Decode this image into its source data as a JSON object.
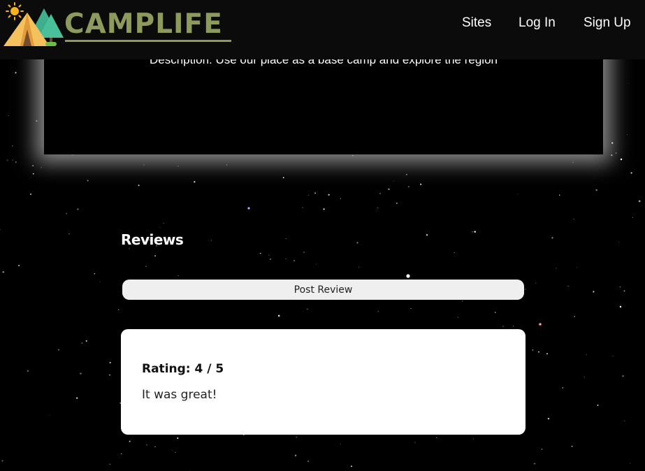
{
  "header": {
    "logo_text": "CAMPLIFE",
    "brand_color": "#8c9b5c",
    "nav": [
      {
        "label": "Sites"
      },
      {
        "label": "Log In"
      },
      {
        "label": "Sign Up"
      }
    ]
  },
  "site": {
    "description": "Description: Use our place as a base camp and explore the region"
  },
  "reviews": {
    "heading": "Reviews",
    "post_button": "Post Review",
    "items": [
      {
        "rating_text": "Rating: 4 / 5",
        "text": "It was great!"
      }
    ]
  },
  "background": {
    "style": "starry night sky"
  }
}
